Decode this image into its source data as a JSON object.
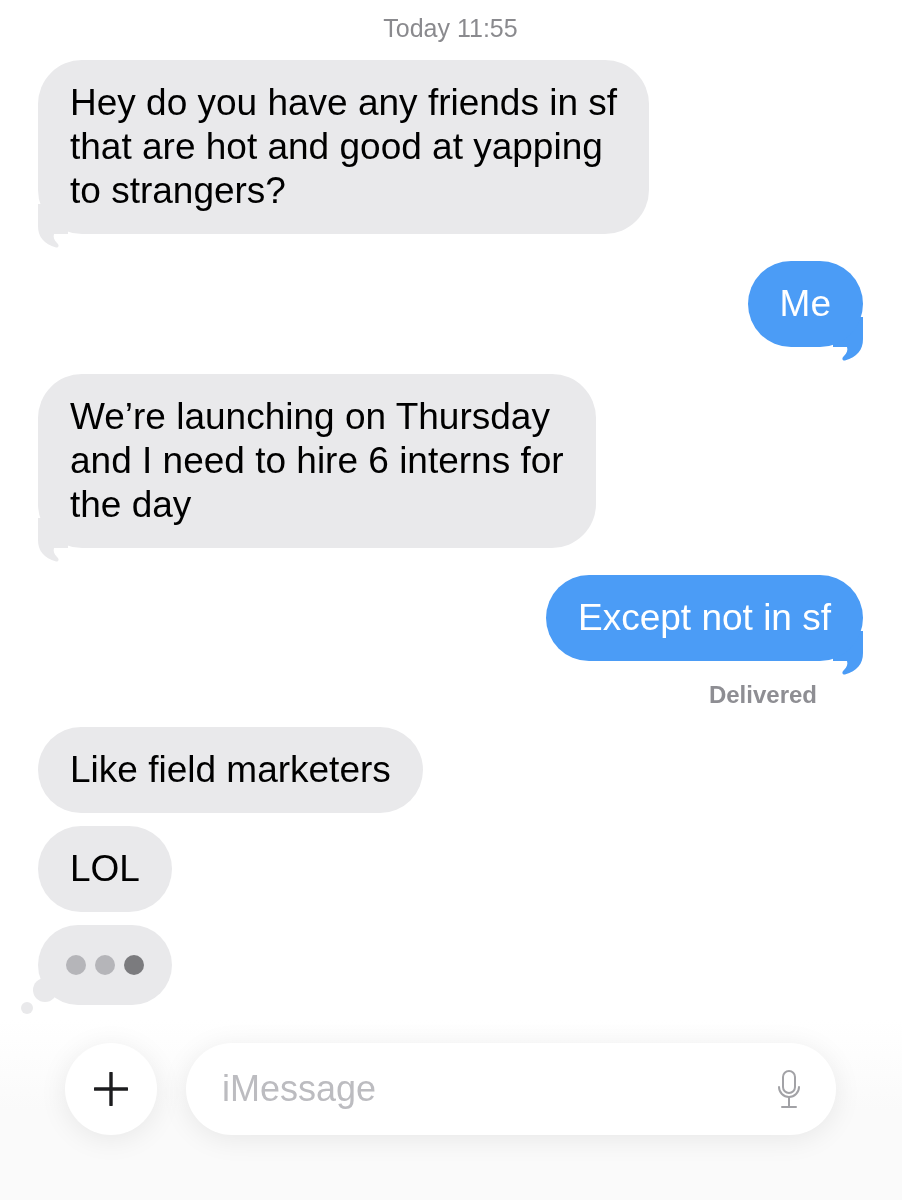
{
  "timestamp": "Today 11:55",
  "messages": [
    {
      "kind": "incoming",
      "text": "Hey do you have any friends in sf\nthat are hot and good at yapping\nto strangers?",
      "tail": true
    },
    {
      "kind": "outgoing",
      "text": "Me",
      "tail": true
    },
    {
      "kind": "incoming",
      "text": "We’re launching on Thursday\nand I need to hire 6 interns for\nthe day",
      "tail": true
    },
    {
      "kind": "outgoing",
      "text": "Except not in sf",
      "tail": true,
      "status": "Delivered"
    },
    {
      "kind": "incoming",
      "text": "Like field marketers",
      "tail": false
    },
    {
      "kind": "incoming",
      "text": "LOL",
      "tail": false
    }
  ],
  "typing_indicator": {
    "dots": [
      {
        "highlighted": false
      },
      {
        "highlighted": false
      },
      {
        "highlighted": true
      }
    ]
  },
  "composer": {
    "placeholder": "iMessage"
  }
}
